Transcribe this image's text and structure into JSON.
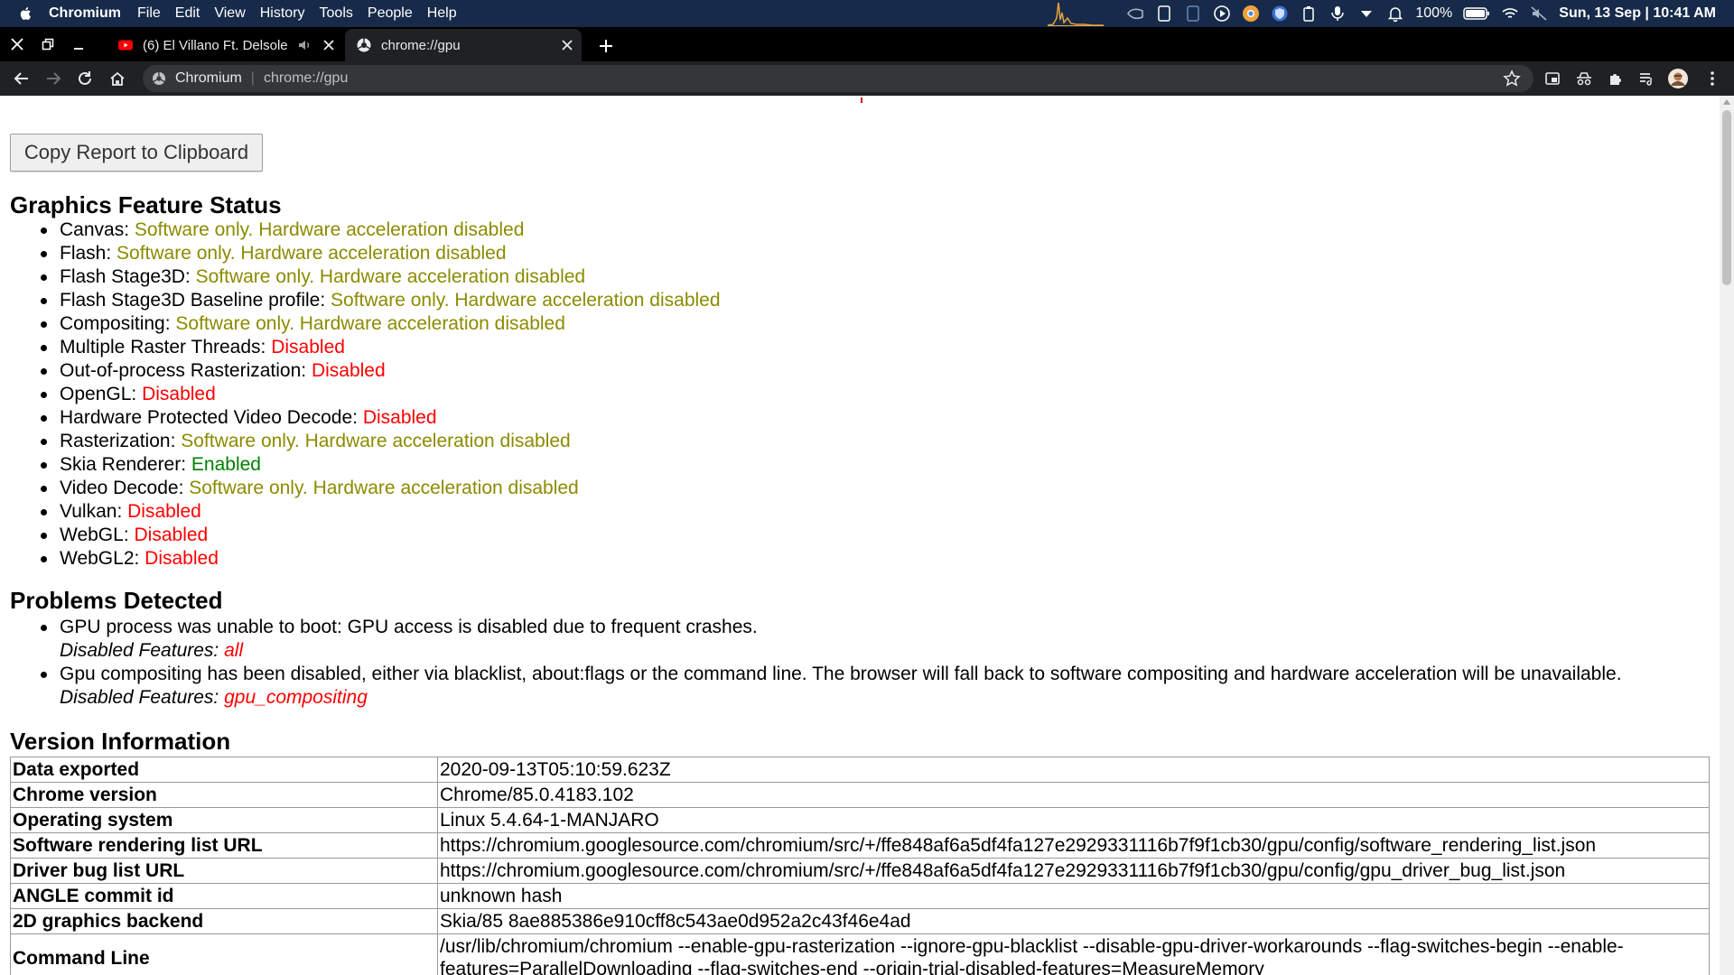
{
  "menubar": {
    "app_name": "Chromium",
    "items": [
      "File",
      "Edit",
      "View",
      "History",
      "Tools",
      "People",
      "Help"
    ],
    "battery_percent": "100%",
    "datetime": "Sun, 13 Sep | 10:41 AM"
  },
  "tabs": [
    {
      "title": "(6) El Villano Ft. Delsole",
      "favicon": "youtube-icon",
      "active": false
    },
    {
      "title": "chrome://gpu",
      "favicon": "globe-icon",
      "active": true
    }
  ],
  "omnibox": {
    "origin": "Chromium",
    "path": "chrome://gpu"
  },
  "page": {
    "copy_button": "Copy Report to Clipboard",
    "feature_heading": "Graphics Feature Status",
    "features": [
      {
        "name": "Canvas",
        "status": "Software only. Hardware acceleration disabled",
        "kind": "soft"
      },
      {
        "name": "Flash",
        "status": "Software only. Hardware acceleration disabled",
        "kind": "soft"
      },
      {
        "name": "Flash Stage3D",
        "status": "Software only. Hardware acceleration disabled",
        "kind": "soft"
      },
      {
        "name": "Flash Stage3D Baseline profile",
        "status": "Software only. Hardware acceleration disabled",
        "kind": "soft"
      },
      {
        "name": "Compositing",
        "status": "Software only. Hardware acceleration disabled",
        "kind": "soft"
      },
      {
        "name": "Multiple Raster Threads",
        "status": "Disabled",
        "kind": "dis"
      },
      {
        "name": "Out-of-process Rasterization",
        "status": "Disabled",
        "kind": "dis"
      },
      {
        "name": "OpenGL",
        "status": "Disabled",
        "kind": "dis"
      },
      {
        "name": "Hardware Protected Video Decode",
        "status": "Disabled",
        "kind": "dis"
      },
      {
        "name": "Rasterization",
        "status": "Software only. Hardware acceleration disabled",
        "kind": "soft"
      },
      {
        "name": "Skia Renderer",
        "status": "Enabled",
        "kind": "en"
      },
      {
        "name": "Video Decode",
        "status": "Software only. Hardware acceleration disabled",
        "kind": "soft"
      },
      {
        "name": "Vulkan",
        "status": "Disabled",
        "kind": "dis"
      },
      {
        "name": "WebGL",
        "status": "Disabled",
        "kind": "dis"
      },
      {
        "name": "WebGL2",
        "status": "Disabled",
        "kind": "dis"
      }
    ],
    "problems_heading": "Problems Detected",
    "disabled_features_label": "Disabled Features:",
    "problems": [
      {
        "text": "GPU process was unable to boot: GPU access is disabled due to frequent crashes.",
        "disabled": "all"
      },
      {
        "text": "Gpu compositing has been disabled, either via blacklist, about:flags or the command line. The browser will fall back to software compositing and hardware acceleration will be unavailable.",
        "disabled": "gpu_compositing"
      }
    ],
    "version_heading": "Version Information",
    "version_rows": [
      {
        "key": "Data exported",
        "value": "2020-09-13T05:10:59.623Z"
      },
      {
        "key": "Chrome version",
        "value": "Chrome/85.0.4183.102"
      },
      {
        "key": "Operating system",
        "value": "Linux 5.4.64-1-MANJARO"
      },
      {
        "key": "Software rendering list URL",
        "value": "https://chromium.googlesource.com/chromium/src/+/ffe848af6a5df4fa127e2929331116b7f9f1cb30/gpu/config/software_rendering_list.json"
      },
      {
        "key": "Driver bug list URL",
        "value": "https://chromium.googlesource.com/chromium/src/+/ffe848af6a5df4fa127e2929331116b7f9f1cb30/gpu/config/gpu_driver_bug_list.json"
      },
      {
        "key": "ANGLE commit id",
        "value": "unknown hash"
      },
      {
        "key": "2D graphics backend",
        "value": "Skia/85 8ae885386e910cff8c543ae0d952a2c43f46e4ad"
      },
      {
        "key": "Command Line",
        "value": "/usr/lib/chromium/chromium --enable-gpu-rasterization --ignore-gpu-blacklist --disable-gpu-driver-workarounds --flag-switches-begin --enable-features=ParallelDownloading --flag-switches-end --origin-trial-disabled-features=MeasureMemory"
      }
    ]
  },
  "colors": {
    "menubar_bg": "#172a49",
    "tabstrip_bg": "#000000",
    "toolbar_bg": "#202124",
    "status_soft": "#8b8b00",
    "status_disabled": "#ff0000",
    "status_enabled": "#008000"
  }
}
